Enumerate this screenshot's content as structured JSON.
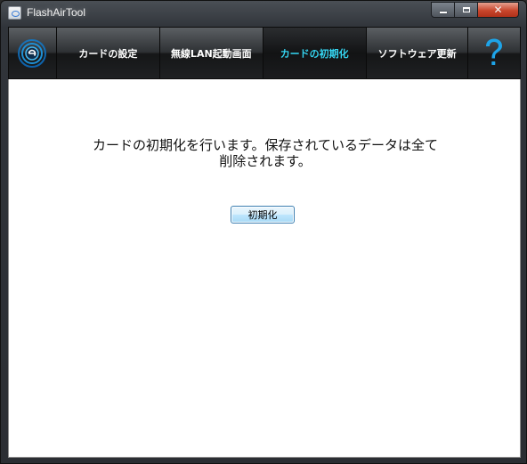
{
  "window": {
    "title": "FlashAirTool",
    "controls": {
      "minimize": "",
      "maximize": "",
      "close": "✕"
    }
  },
  "nav": {
    "logo_icon": "flashair-logo-icon",
    "help_icon": "help-question-icon",
    "tabs": [
      {
        "label": "カードの設定",
        "active": false
      },
      {
        "label": "無線LAN起動画面",
        "active": false
      },
      {
        "label": "カードの初期化",
        "active": true
      },
      {
        "label": "ソフトウェア更新",
        "active": false
      }
    ]
  },
  "main": {
    "message_line1": "カードの初期化を行います。保存されているデータは全て",
    "message_line2": "削除されます。",
    "init_button_label": "初期化"
  },
  "colors": {
    "active_tab_text": "#35d6f2",
    "help_icon": "#1ea4e8",
    "logo_ring": "#1e90d6"
  }
}
